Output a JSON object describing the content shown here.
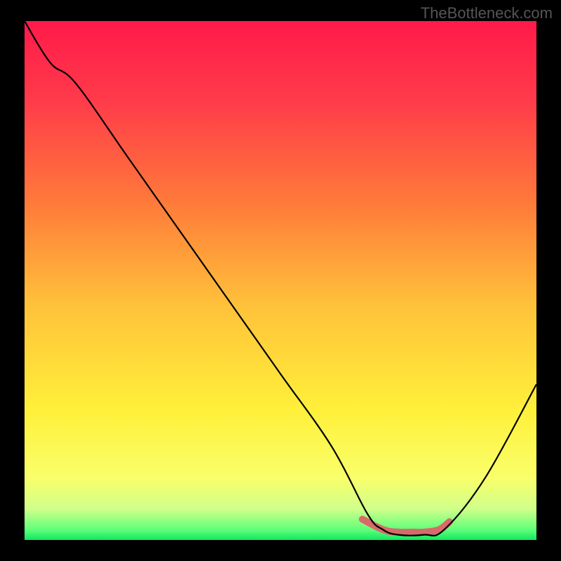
{
  "watermark": "TheBottleneck.com",
  "chart_data": {
    "type": "line",
    "title": "",
    "xlabel": "",
    "ylabel": "",
    "xlim": [
      0,
      100
    ],
    "ylim": [
      0,
      100
    ],
    "series": [
      {
        "name": "bottleneck-curve",
        "x": [
          0,
          5,
          10,
          20,
          30,
          40,
          50,
          60,
          67,
          70,
          73,
          78,
          82,
          90,
          100
        ],
        "y": [
          100,
          92,
          88,
          74,
          60,
          46,
          32,
          18,
          5,
          2,
          1,
          1,
          2,
          12,
          30
        ],
        "color": "#000000"
      }
    ],
    "gradient": {
      "stops": [
        {
          "pos": 0.0,
          "color": "#ff1a4a"
        },
        {
          "pos": 0.15,
          "color": "#ff3a4a"
        },
        {
          "pos": 0.35,
          "color": "#ff7a3a"
        },
        {
          "pos": 0.55,
          "color": "#ffc23a"
        },
        {
          "pos": 0.75,
          "color": "#fff03a"
        },
        {
          "pos": 0.88,
          "color": "#f9ff6a"
        },
        {
          "pos": 0.94,
          "color": "#d0ff8a"
        },
        {
          "pos": 0.98,
          "color": "#60ff7a"
        },
        {
          "pos": 1.0,
          "color": "#10e860"
        }
      ]
    },
    "highlight": {
      "x": [
        66,
        70,
        73,
        76,
        78,
        81,
        83
      ],
      "y": [
        4,
        2,
        1.5,
        1.5,
        1.5,
        2,
        3.5
      ],
      "color": "#d86a6a",
      "width": 10
    }
  }
}
